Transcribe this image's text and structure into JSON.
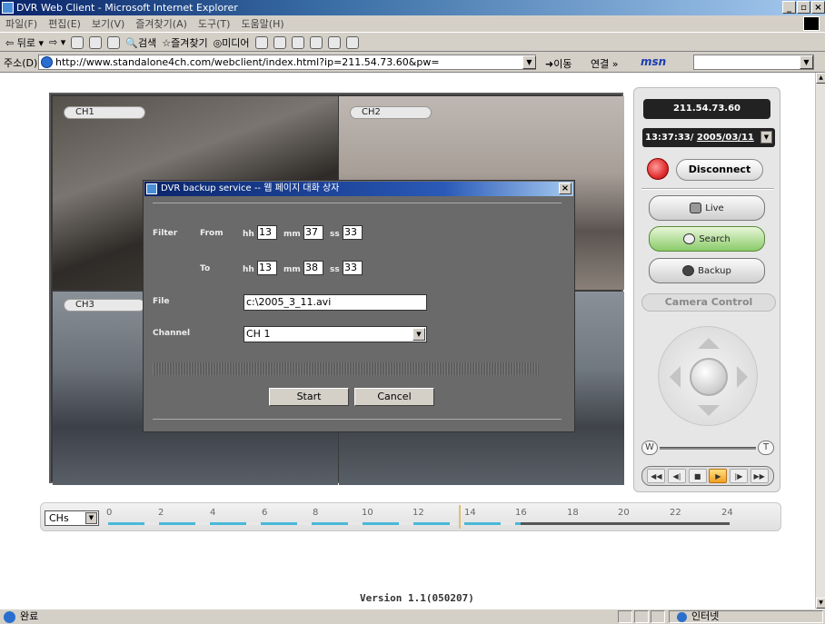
{
  "window": {
    "title": "DVR Web Client - Microsoft Internet Explorer"
  },
  "menu": [
    "파일(F)",
    "편집(E)",
    "보기(V)",
    "즐겨찾기(A)",
    "도구(T)",
    "도움말(H)"
  ],
  "toolbar": {
    "back": "뒤로",
    "search": "검색",
    "favorites": "즐겨찾기",
    "media": "미디어"
  },
  "address": {
    "label": "주소(D)",
    "url": "http://www.standalone4ch.com/webclient/index.html?ip=211.54.73.60&pw=",
    "go": "이동",
    "links": "연결",
    "msn": "msn"
  },
  "cameras": [
    "CH1",
    "CH2",
    "CH3"
  ],
  "panel": {
    "ip": "211.54.73.60",
    "time": "13:37:33/",
    "date": "2005/03/11",
    "disconnect": "Disconnect",
    "live": "Live",
    "search": "Search",
    "backup": "Backup",
    "camera_control": "Camera Control",
    "zoom_w": "W",
    "zoom_t": "T"
  },
  "timeline": {
    "channels_select": "CHs",
    "hours": [
      "0",
      "2",
      "4",
      "6",
      "8",
      "10",
      "12",
      "14",
      "16",
      "18",
      "20",
      "22",
      "24"
    ]
  },
  "dialog": {
    "title": "DVR backup service -- 웹 페이지 대화 상자",
    "filter_label": "Filter",
    "from_label": "From",
    "to_label": "To",
    "hh": "hh",
    "mm": "mm",
    "ss": "ss",
    "from_hh": "13",
    "from_mm": "37",
    "from_ss": "33",
    "to_hh": "13",
    "to_mm": "38",
    "to_ss": "33",
    "file_label": "File",
    "file_value": "c:\\2005_3_11.avi",
    "channel_label": "Channel",
    "channel_value": "CH 1",
    "start": "Start",
    "cancel": "Cancel"
  },
  "version": "Version 1.1(050207)",
  "status": {
    "text": "완료",
    "zone": "인터넷"
  }
}
